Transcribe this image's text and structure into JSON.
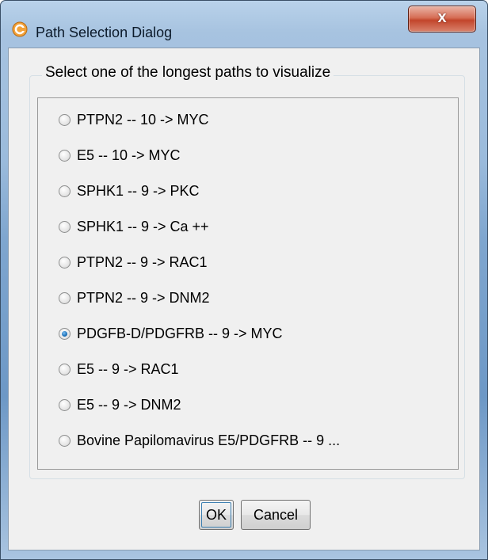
{
  "window": {
    "title": "Path Selection Dialog",
    "close_glyph": "x",
    "icon": "java-app-icon"
  },
  "group": {
    "legend": "Select one of the longest paths to visualize"
  },
  "paths": [
    {
      "label": "PTPN2 -- 10 -> MYC",
      "selected": false
    },
    {
      "label": "E5 -- 10 -> MYC",
      "selected": false
    },
    {
      "label": "SPHK1 -- 9 -> PKC",
      "selected": false
    },
    {
      "label": "SPHK1 -- 9 -> Ca ++",
      "selected": false
    },
    {
      "label": "PTPN2 -- 9 -> RAC1",
      "selected": false
    },
    {
      "label": "PTPN2 -- 9 -> DNM2",
      "selected": false
    },
    {
      "label": "PDGFB-D/PDGFRB -- 9 -> MYC",
      "selected": true
    },
    {
      "label": "E5 -- 9 -> RAC1",
      "selected": false
    },
    {
      "label": "E5 -- 9 -> DNM2",
      "selected": false
    },
    {
      "label": "Bovine Papilomavirus E5/PDGFRB -- 9 ...",
      "selected": false
    }
  ],
  "buttons": {
    "ok": "OK",
    "cancel": "Cancel"
  }
}
